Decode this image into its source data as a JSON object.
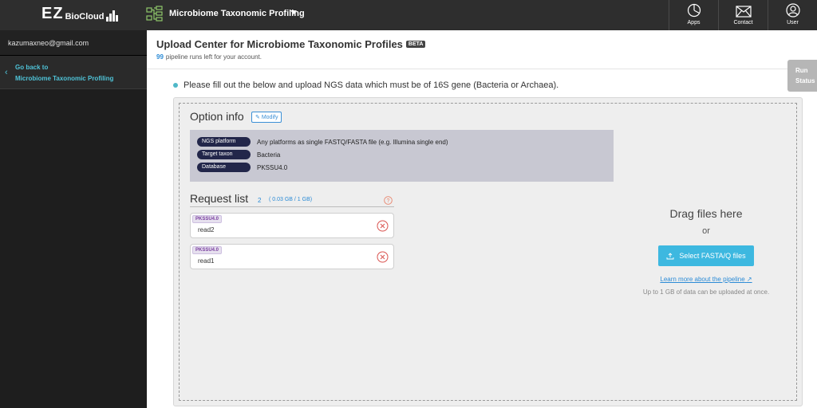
{
  "header": {
    "logo_text": "EZ",
    "logo_sub": "BioCloud",
    "app_title": "Microbiome Taxonomic Profiling",
    "nav": [
      {
        "label": "Apps",
        "icon": "pie-chart-icon"
      },
      {
        "label": "Contact",
        "icon": "envelope-icon"
      },
      {
        "label": "User",
        "icon": "user-icon"
      }
    ]
  },
  "sidebar": {
    "email": "kazumaxneo@gmail.com",
    "back_line1": "Go back to",
    "back_line2": "Microbiome Taxonomic Profiling"
  },
  "page": {
    "title": "Upload Center for Microbiome Taxonomic Profiles",
    "badge": "BETA",
    "runs_count": "99",
    "runs_text": "pipeline runs left for your account.",
    "instruction": "Please fill out the below and upload NGS data which must be of 16S gene (Bacteria or Archaea).",
    "run_status_line1": "Run",
    "run_status_line2": "Status"
  },
  "option_info": {
    "title": "Option info",
    "modify_label": "Modify",
    "rows": [
      {
        "key": "NGS platform",
        "value": "Any platforms as single FASTQ/FASTA file (e.g. Illumina single end)"
      },
      {
        "key": "Target taxon",
        "value": "Bacteria"
      },
      {
        "key": "Database",
        "value": "PKSSU4.0"
      }
    ]
  },
  "request_list": {
    "title": "Request list",
    "count": "2",
    "size": "( 0.03 GB / 1 GB)",
    "items": [
      {
        "tag": "PKSSU4.0",
        "name": "read2"
      },
      {
        "tag": "PKSSU4.0",
        "name": "read1"
      }
    ]
  },
  "dropzone": {
    "title": "Drag files here",
    "or": "or",
    "button_label": "Select FASTA/Q files",
    "learn_more": "Learn more about the pipeline",
    "limit_note": "Up to 1 GB of data can be uploaded at once."
  },
  "colors": {
    "accent": "#3db8e0",
    "link": "#2b8bd6",
    "sidebar_link": "#4fc3d8",
    "topbar": "#2e2e2e"
  }
}
